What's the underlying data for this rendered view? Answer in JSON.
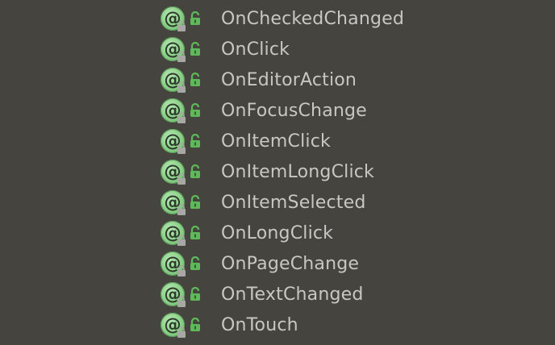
{
  "structure": {
    "items": [
      {
        "label": "OnCheckedChanged",
        "icon": "annotation-icon",
        "visibility_icon": "public-lock-icon"
      },
      {
        "label": "OnClick",
        "icon": "annotation-icon",
        "visibility_icon": "public-lock-icon"
      },
      {
        "label": "OnEditorAction",
        "icon": "annotation-icon",
        "visibility_icon": "public-lock-icon"
      },
      {
        "label": "OnFocusChange",
        "icon": "annotation-icon",
        "visibility_icon": "public-lock-icon"
      },
      {
        "label": "OnItemClick",
        "icon": "annotation-icon",
        "visibility_icon": "public-lock-icon"
      },
      {
        "label": "OnItemLongClick",
        "icon": "annotation-icon",
        "visibility_icon": "public-lock-icon"
      },
      {
        "label": "OnItemSelected",
        "icon": "annotation-icon",
        "visibility_icon": "public-lock-icon"
      },
      {
        "label": "OnLongClick",
        "icon": "annotation-icon",
        "visibility_icon": "public-lock-icon"
      },
      {
        "label": "OnPageChange",
        "icon": "annotation-icon",
        "visibility_icon": "public-lock-icon"
      },
      {
        "label": "OnTextChanged",
        "icon": "annotation-icon",
        "visibility_icon": "public-lock-icon"
      },
      {
        "label": "OnTouch",
        "icon": "annotation-icon",
        "visibility_icon": "public-lock-icon"
      }
    ]
  },
  "colors": {
    "background": "#45443f",
    "label_text": "#c8c7c2",
    "annotation_icon": "#8fd28c",
    "public_lock": "#5fb85a"
  }
}
